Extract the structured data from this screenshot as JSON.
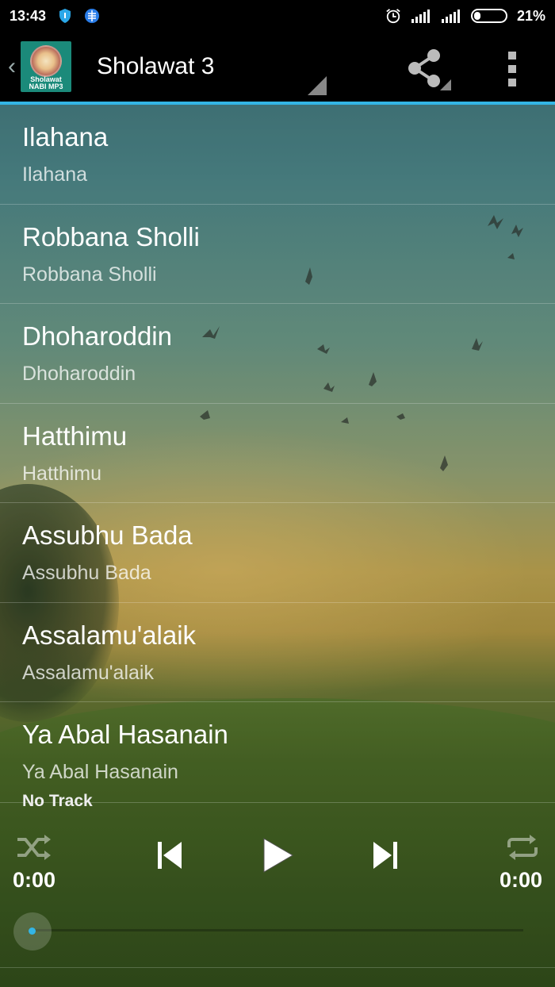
{
  "status_bar": {
    "time": "13:43",
    "battery": "21%",
    "battery_level": 0.21,
    "icons": [
      "shield-icon",
      "browser-icon",
      "alarm-icon",
      "signal-icon",
      "signal-icon",
      "battery-icon"
    ]
  },
  "action_bar": {
    "logo_text_line1": "Sholawat",
    "logo_text_line2": "NABI MP3",
    "title": "Sholawat 3",
    "accent_color": "#33b5e5"
  },
  "tracks": [
    {
      "title": "Ilahana",
      "subtitle": "Ilahana"
    },
    {
      "title": "Robbana Sholli",
      "subtitle": "Robbana Sholli"
    },
    {
      "title": "Dhoharoddin",
      "subtitle": "Dhoharoddin"
    },
    {
      "title": "Hatthimu",
      "subtitle": "Hatthimu"
    },
    {
      "title": "Assubhu Bada",
      "subtitle": "Assubhu Bada"
    },
    {
      "title": "Assalamu'alaik",
      "subtitle": "Assalamu'alaik"
    },
    {
      "title": "Ya Abal Hasanain",
      "subtitle": "Ya Abal Hasanain"
    }
  ],
  "player": {
    "now_playing": "No Track",
    "elapsed": "0:00",
    "duration": "0:00",
    "progress": 0
  }
}
